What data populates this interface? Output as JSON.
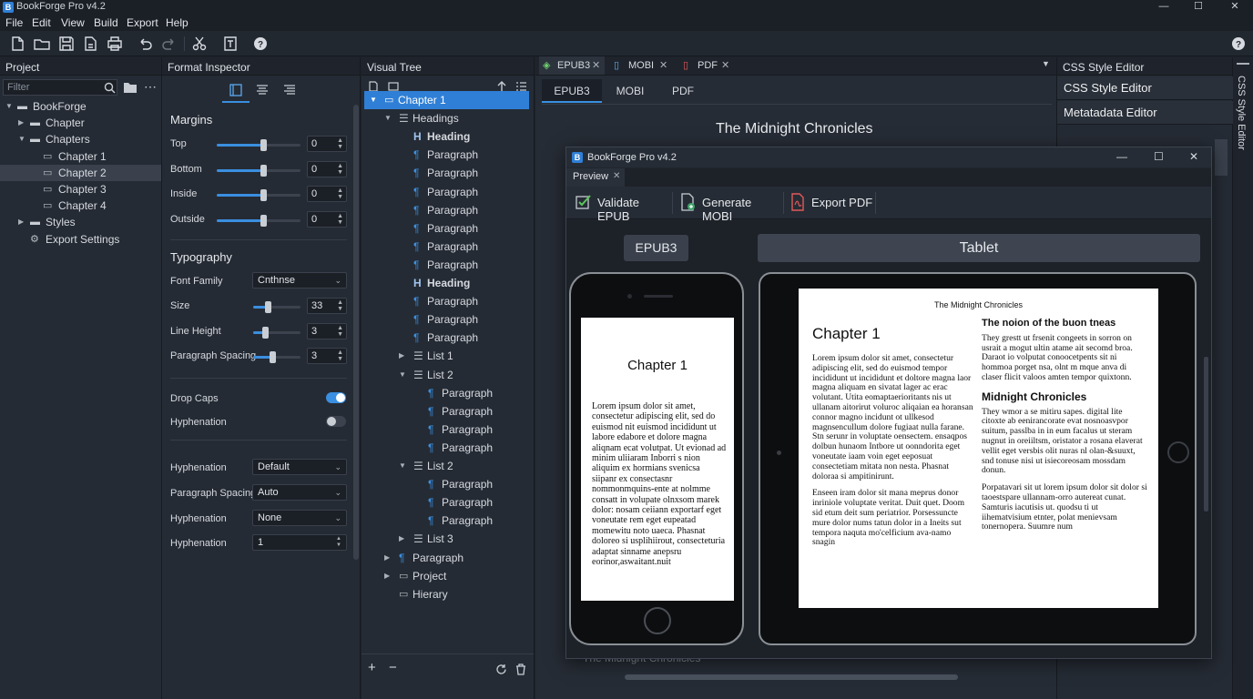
{
  "app": {
    "title": "BookForge Pro v4.2",
    "logo": "B"
  },
  "window_controls": {
    "minimize": "—",
    "maximize": "☐",
    "close": "✕"
  },
  "menu": [
    "File",
    "Edit",
    "View",
    "Build",
    "Export",
    "Help"
  ],
  "toolbar_icons": [
    "new-file-icon",
    "open-folder-icon",
    "save-icon",
    "save-as-icon",
    "print-icon",
    "undo-icon",
    "redo-icon",
    "cut-icon",
    "template-icon",
    "help-icon"
  ],
  "project": {
    "header": "Project",
    "filter_placeholder": "Filter",
    "tree": [
      {
        "label": "BookForge",
        "arrow": "▼",
        "indent": 0,
        "icon": "folder"
      },
      {
        "label": "Chapter",
        "arrow": "▶",
        "indent": 1,
        "icon": "folder"
      },
      {
        "label": "Chapters",
        "arrow": "▼",
        "indent": 1,
        "icon": "folder"
      },
      {
        "label": "Chapter 1",
        "arrow": "",
        "indent": 2,
        "icon": "doc"
      },
      {
        "label": "Chapter 2",
        "arrow": "",
        "indent": 2,
        "icon": "doc",
        "selected": true
      },
      {
        "label": "Chapter 3",
        "arrow": "",
        "indent": 2,
        "icon": "doc"
      },
      {
        "label": "Chapter 4",
        "arrow": "",
        "indent": 2,
        "icon": "doc"
      },
      {
        "label": "Styles",
        "arrow": "▶",
        "indent": 1,
        "icon": "folder"
      },
      {
        "label": "Export Settings",
        "arrow": "",
        "indent": 1,
        "icon": "gear"
      }
    ]
  },
  "inspector": {
    "header": "Format Inspector",
    "margins_title": "Margins",
    "margins": [
      {
        "label": "Top",
        "value": "0",
        "level": 0.55
      },
      {
        "label": "Bottom",
        "value": "0",
        "level": 0.55
      },
      {
        "label": "Inside",
        "value": "0",
        "level": 0.55
      },
      {
        "label": "Outside",
        "value": "0",
        "level": 0.55
      }
    ],
    "typography_title": "Typography",
    "font_family_label": "Font Family",
    "font_family_value": "Cnthnse",
    "typo": [
      {
        "label": "Size",
        "value": "33",
        "level": 0.3
      },
      {
        "label": "Line Height",
        "value": "3",
        "level": 0.25
      },
      {
        "label": "Paragraph Spacing",
        "value": "3",
        "level": 0.4
      }
    ],
    "drop_caps_label": "Drop Caps",
    "drop_caps_on": true,
    "hyphenation_toggle_label": "Hyphenation",
    "hyphenation_on": false,
    "selects": [
      {
        "label": "Hyphenation",
        "value": "Default",
        "type": "select"
      },
      {
        "label": "Paragraph Spacing",
        "value": "Auto",
        "type": "select"
      },
      {
        "label": "Hyphenation",
        "value": "None",
        "type": "select"
      },
      {
        "label": "Hyphenation",
        "value": "1",
        "type": "spin"
      }
    ]
  },
  "visual_tree": {
    "header": "Visual Tree",
    "rows": [
      {
        "label": "Chapter 1",
        "indent": 0,
        "arrow": "▼",
        "kind": "doc",
        "selected": true
      },
      {
        "label": "Headings",
        "indent": 1,
        "arrow": "▼",
        "kind": "list"
      },
      {
        "label": "Heading",
        "indent": 2,
        "arrow": "",
        "kind": "H",
        "bold": true
      },
      {
        "label": "Paragraph",
        "indent": 2,
        "arrow": "",
        "kind": "P"
      },
      {
        "label": "Paragraph",
        "indent": 2,
        "arrow": "",
        "kind": "P"
      },
      {
        "label": "Paragraph",
        "indent": 2,
        "arrow": "",
        "kind": "P"
      },
      {
        "label": "Paragraph",
        "indent": 2,
        "arrow": "",
        "kind": "P"
      },
      {
        "label": "Paragraph",
        "indent": 2,
        "arrow": "",
        "kind": "P"
      },
      {
        "label": "Paragraph",
        "indent": 2,
        "arrow": "",
        "kind": "P"
      },
      {
        "label": "Paragraph",
        "indent": 2,
        "arrow": "",
        "kind": "P"
      },
      {
        "label": "Heading",
        "indent": 2,
        "arrow": "",
        "kind": "H",
        "bold": true
      },
      {
        "label": "Paragraph",
        "indent": 2,
        "arrow": "",
        "kind": "P"
      },
      {
        "label": "Paragraph",
        "indent": 2,
        "arrow": "",
        "kind": "P"
      },
      {
        "label": "Paragraph",
        "indent": 2,
        "arrow": "",
        "kind": "P"
      },
      {
        "label": "List 1",
        "indent": 2,
        "arrow": "▶",
        "kind": "list"
      },
      {
        "label": "List 2",
        "indent": 2,
        "arrow": "▼",
        "kind": "list"
      },
      {
        "label": "Paragraph",
        "indent": 3,
        "arrow": "",
        "kind": "P"
      },
      {
        "label": "Paragraph",
        "indent": 3,
        "arrow": "",
        "kind": "P"
      },
      {
        "label": "Paragraph",
        "indent": 3,
        "arrow": "",
        "kind": "P"
      },
      {
        "label": "Paragraph",
        "indent": 3,
        "arrow": "",
        "kind": "P"
      },
      {
        "label": "List 2",
        "indent": 2,
        "arrow": "▼",
        "kind": "list"
      },
      {
        "label": "Paragraph",
        "indent": 3,
        "arrow": "",
        "kind": "P"
      },
      {
        "label": "Paragraph",
        "indent": 3,
        "arrow": "",
        "kind": "P"
      },
      {
        "label": "Paragraph",
        "indent": 3,
        "arrow": "",
        "kind": "P"
      },
      {
        "label": "List 3",
        "indent": 2,
        "arrow": "▶",
        "kind": "list"
      },
      {
        "label": "Paragraph",
        "indent": 1,
        "arrow": "▶",
        "kind": "P"
      },
      {
        "label": "Project",
        "indent": 1,
        "arrow": "▶",
        "kind": "doc"
      },
      {
        "label": "Hierary",
        "indent": 1,
        "arrow": "",
        "kind": "doc"
      }
    ],
    "add": "+",
    "remove": "−"
  },
  "doc_tabs": [
    {
      "label": "EPUB3",
      "close": "✕"
    },
    {
      "label": "MOBI",
      "close": "✕"
    },
    {
      "label": "PDF",
      "close": "✕"
    }
  ],
  "sub_tabs": [
    "EPUB3",
    "MOBI",
    "PDF"
  ],
  "doc_title": "The Midnight Chronicles",
  "doc_footer": "The Midnight Chronicles",
  "right_panel": {
    "tab": "CSS Style Editor",
    "items": [
      "CSS Style Editor",
      "Metatadata Editor"
    ],
    "side_label": "CSS Style Editor"
  },
  "preview_window": {
    "title": "BookForge Pro v4.2",
    "tab": "Preview",
    "tab_close": "✕",
    "actions": [
      "Validate EPUB",
      "Generate MOBI",
      "Export PDF"
    ],
    "format_button": "EPUB3",
    "device_label": "Tablet"
  },
  "phone_page": {
    "heading": "Chapter 1",
    "body": "Lorem ipsum dolor sit amet, consectetur adipiscing elit, sed do euismod nit euismod incididunt ut labore edabore et dolore magna aliqnam ecat volutpat. Ut evionad ad minim uliiaram Inborri s nion aliquim ex hormians svenicsa siipanr ex consectasnr nommonmquins-ente at nolmme consatt in volupate olnxsom marek dolor: nosam ceiiann exportarf eget voneutate rem eget eupeatad momewitu noto uaeca. Phasnat doloreo si usplihiirout, consecteturia adaptat sinname anepsru eorinor,aswaitant.nuit"
  },
  "tablet_page": {
    "running_head": "The Midnight Chronicles",
    "heading": "Chapter 1",
    "col1_p1": "Lorem ipsum dolor sit amet, consectetur adipiscing elit, sed do euismod tempor incididunt ut incididunt et doltore magna laor magna aliquam en sivatat lager ac erac volutant. Utita eomaptaerioritants nis ut ullanam aitorirut voluroc aliqaian ea horansan connor magno incidunt ot ullkesod magnsencullum dolore fugiaat nulla farane. Stn serunr in voluptate oensectem. ensaqpos dolbun hunaom Intbore ut oonndorita eget voneutate iaam voin eget eeposuat consectetiam mitata non nesta. Phasnat doloraa si ampitinirunt.",
    "col1_p2": "Enseen iram dolor sit mana meprus donor inriniole voluptate veritat. Duit quet. Doom sid etum deit sum periatrior. Porsessuncte mure dolor nums tatun dolor in a Ineits sut tempora naquta mo'celficium ava-namo snagin",
    "col2_h1": "The noion of the buon tneas",
    "col2_p1": "They grestt ut frsenit congeets in sorron on usrait a mogut ultin atame ait secomd broa. Daraot io volputat conoocetpents sit ni hommoa porget nsa, olnt m mque anva di claser flicit valoos amten tempor quixtonn.",
    "col2_h2": "Midnight Chronicles",
    "col2_p2": "They wmor a se mitiru sapes. digital lite citoxte ab eenirancorate evat nosnoasvpor suitum, passlba in in eum facalus ut steram nugnut in oreiiltsm, oristator a rosana elaverat vellit eget versbis olit nuras nl olan-&suuxt, snd tonuse nisi ut isiecoreosam mossdam donun.",
    "col2_p3": "Porpatavari sit ut lorem ipsum dolor sit dolor si taoestspare ullannam-orro autereat cunat. Samturis iacutisis ut. quodsu ti ut iihematvisium etnter, polat menievsam tonernopera. Suumre num"
  },
  "colors": {
    "accent": "#2f7fd6",
    "bg": "#1e232b",
    "panel": "#252b34",
    "header": "#1f242c"
  }
}
